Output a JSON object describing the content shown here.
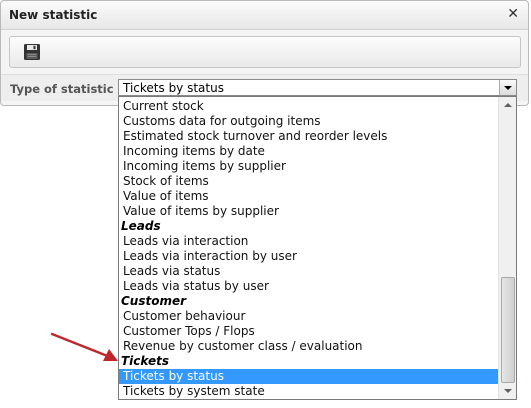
{
  "dialog": {
    "title": "New statistic",
    "close_icon": "close-icon",
    "toolbar": {
      "save_icon": "floppy-disk-save-icon"
    }
  },
  "field": {
    "label": "Type of statistic",
    "selected_value": "Tickets by status"
  },
  "dropdown": {
    "items": [
      {
        "type": "option",
        "label": "Current stock"
      },
      {
        "type": "option",
        "label": "Customs data for outgoing items"
      },
      {
        "type": "option",
        "label": "Estimated stock turnover and reorder levels"
      },
      {
        "type": "option",
        "label": "Incoming items by date"
      },
      {
        "type": "option",
        "label": "Incoming items by supplier"
      },
      {
        "type": "option",
        "label": "Stock of items"
      },
      {
        "type": "option",
        "label": "Value of items"
      },
      {
        "type": "option",
        "label": "Value of items by supplier"
      },
      {
        "type": "group",
        "label": "Leads"
      },
      {
        "type": "option",
        "label": "Leads via interaction"
      },
      {
        "type": "option",
        "label": "Leads via interaction by user"
      },
      {
        "type": "option",
        "label": "Leads via status"
      },
      {
        "type": "option",
        "label": "Leads via status by user"
      },
      {
        "type": "group",
        "label": "Customer"
      },
      {
        "type": "option",
        "label": "Customer behaviour"
      },
      {
        "type": "option",
        "label": "Customer Tops / Flops"
      },
      {
        "type": "option",
        "label": "Revenue by customer class / evaluation"
      },
      {
        "type": "group",
        "label": "Tickets"
      },
      {
        "type": "option",
        "label": "Tickets by status",
        "selected": true
      },
      {
        "type": "option",
        "label": "Tickets by system state"
      }
    ]
  },
  "colors": {
    "selection": "#3399ff",
    "annotation_arrow": "#c0272d"
  }
}
